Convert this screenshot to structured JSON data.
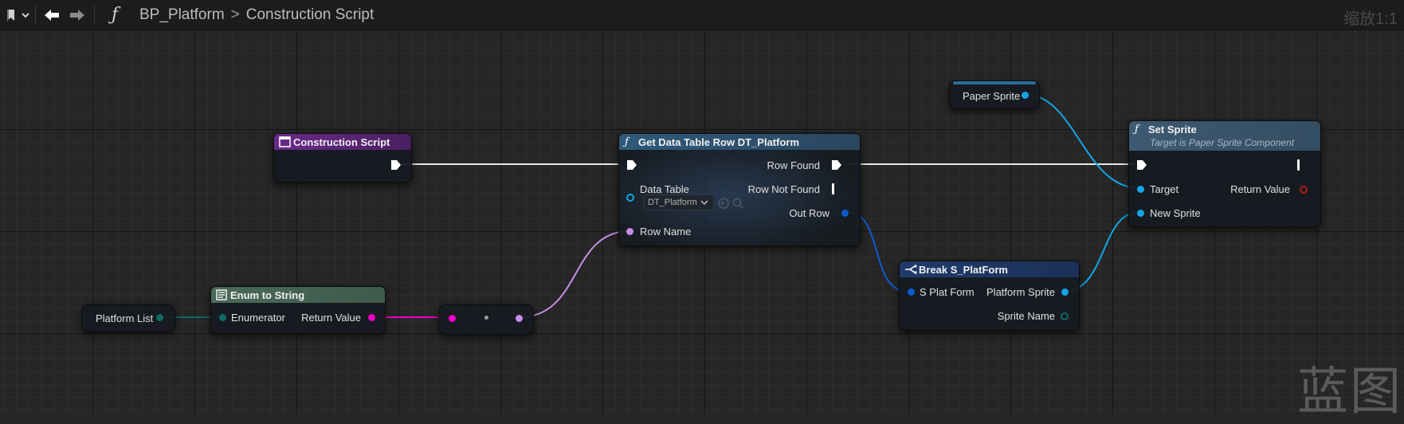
{
  "toolbar": {
    "bookmark_icon": "bookmark-icon",
    "back_icon": "arrow-left-icon",
    "forward_icon": "arrow-right-icon",
    "function_icon": "function-icon"
  },
  "breadcrumb": {
    "blueprint": "BP_Platform",
    "separator": ">",
    "graph": "Construction Script"
  },
  "zoom_label": "缩放1:1",
  "watermark": "蓝图",
  "colors": {
    "exec": "#ffffff",
    "struct": "#0c5bd1",
    "object": "#12a6e6",
    "enum": "#0d6b62",
    "string": "#f000c8",
    "name": "#c88ee8"
  },
  "nodes": {
    "construction_script": {
      "title": "Construction Script"
    },
    "get_data_table_row": {
      "title": "Get Data Table Row DT_Platform",
      "data_table_label": "Data Table",
      "data_table_value": "DT_Platform",
      "row_name_label": "Row Name",
      "row_found_label": "Row Found",
      "row_not_found_label": "Row Not Found",
      "out_row_label": "Out Row"
    },
    "paper_sprite": {
      "label": "Paper Sprite"
    },
    "set_sprite": {
      "title": "Set Sprite",
      "subtitle": "Target is Paper Sprite Component",
      "target_label": "Target",
      "new_sprite_label": "New Sprite",
      "return_value_label": "Return Value"
    },
    "break_platform": {
      "title": "Break S_PlatForm",
      "input_label": "S Plat Form",
      "platform_sprite_label": "Platform Sprite",
      "sprite_name_label": "Sprite Name"
    },
    "platform_list": {
      "label": "Platform List"
    },
    "enum_to_string": {
      "title": "Enum to String",
      "enumerator_label": "Enumerator",
      "return_value_label": "Return Value"
    }
  }
}
